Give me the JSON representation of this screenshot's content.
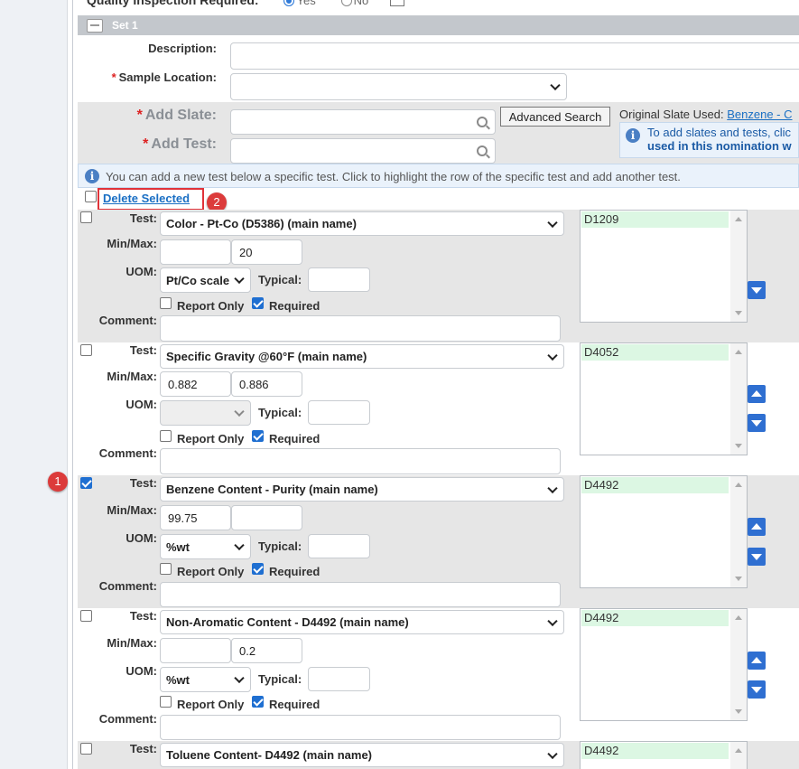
{
  "header": {
    "quality_label": "Quality Inspection Required:",
    "yes": "Yes",
    "no": "No"
  },
  "set": {
    "title": "Set 1"
  },
  "form": {
    "description_label": "Description:",
    "sample_location_label": "Sample Location:",
    "required_mark": "*",
    "add_slate_label": "Add Slate:",
    "add_test_label": "Add Test:",
    "advanced_search": "Advanced Search",
    "original_slate_label": "Original Slate Used:",
    "original_slate_link": "Benzene - C",
    "slate_info_line1": "To add slates and tests, clic",
    "slate_info_line2": "used in this nomination w"
  },
  "info": {
    "text": "You can add a new test below a specific test. Click to highlight the row of the specific test and add another test."
  },
  "actions": {
    "delete_selected": "Delete Selected"
  },
  "labels": {
    "test": "Test:",
    "minmax": "Min/Max:",
    "uom": "UOM:",
    "typical": "Typical:",
    "report_only": "Report Only",
    "required": "Required",
    "comment": "Comment:"
  },
  "annotations": {
    "step1": "1",
    "step2": "2"
  },
  "rows": [
    {
      "test": "Color - Pt-Co (D5386) (main name)",
      "min": "",
      "max": "20",
      "uom": "Pt/Co scale",
      "method": "D1209",
      "checked": false
    },
    {
      "test": "Specific Gravity @60°F (main name)",
      "min": "0.882",
      "max": "0.886",
      "uom": "",
      "method": "D4052",
      "checked": false
    },
    {
      "test": "Benzene Content - Purity (main name)",
      "min": "99.75",
      "max": "",
      "uom": "%wt",
      "method": "D4492",
      "checked": true
    },
    {
      "test": "Non-Aromatic Content - D4492 (main name)",
      "min": "",
      "max": "0.2",
      "uom": "%wt",
      "method": "D4492",
      "checked": false
    },
    {
      "test": "Toluene Content- D4492 (main name)",
      "min": "",
      "max": "",
      "uom": "",
      "method": "D4492",
      "checked": false
    }
  ],
  "colors": {
    "accent": "#1f6fd1",
    "highlight": "#e0333a",
    "method_bg": "#dcf7e3"
  }
}
